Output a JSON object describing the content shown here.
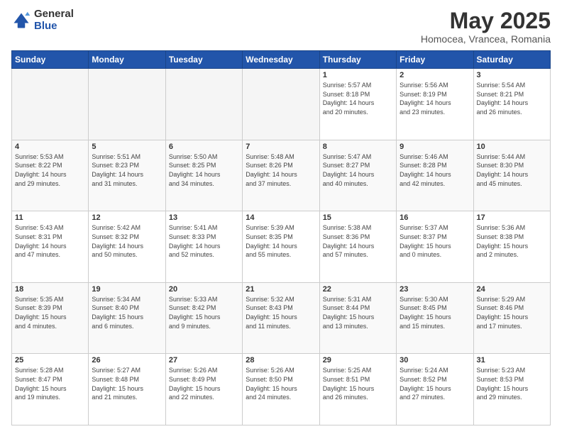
{
  "logo": {
    "general": "General",
    "blue": "Blue"
  },
  "title": "May 2025",
  "location": "Homocea, Vrancea, Romania",
  "weekdays": [
    "Sunday",
    "Monday",
    "Tuesday",
    "Wednesday",
    "Thursday",
    "Friday",
    "Saturday"
  ],
  "weeks": [
    [
      {
        "day": "",
        "info": ""
      },
      {
        "day": "",
        "info": ""
      },
      {
        "day": "",
        "info": ""
      },
      {
        "day": "",
        "info": ""
      },
      {
        "day": "1",
        "info": "Sunrise: 5:57 AM\nSunset: 8:18 PM\nDaylight: 14 hours\nand 20 minutes."
      },
      {
        "day": "2",
        "info": "Sunrise: 5:56 AM\nSunset: 8:19 PM\nDaylight: 14 hours\nand 23 minutes."
      },
      {
        "day": "3",
        "info": "Sunrise: 5:54 AM\nSunset: 8:21 PM\nDaylight: 14 hours\nand 26 minutes."
      }
    ],
    [
      {
        "day": "4",
        "info": "Sunrise: 5:53 AM\nSunset: 8:22 PM\nDaylight: 14 hours\nand 29 minutes."
      },
      {
        "day": "5",
        "info": "Sunrise: 5:51 AM\nSunset: 8:23 PM\nDaylight: 14 hours\nand 31 minutes."
      },
      {
        "day": "6",
        "info": "Sunrise: 5:50 AM\nSunset: 8:25 PM\nDaylight: 14 hours\nand 34 minutes."
      },
      {
        "day": "7",
        "info": "Sunrise: 5:48 AM\nSunset: 8:26 PM\nDaylight: 14 hours\nand 37 minutes."
      },
      {
        "day": "8",
        "info": "Sunrise: 5:47 AM\nSunset: 8:27 PM\nDaylight: 14 hours\nand 40 minutes."
      },
      {
        "day": "9",
        "info": "Sunrise: 5:46 AM\nSunset: 8:28 PM\nDaylight: 14 hours\nand 42 minutes."
      },
      {
        "day": "10",
        "info": "Sunrise: 5:44 AM\nSunset: 8:30 PM\nDaylight: 14 hours\nand 45 minutes."
      }
    ],
    [
      {
        "day": "11",
        "info": "Sunrise: 5:43 AM\nSunset: 8:31 PM\nDaylight: 14 hours\nand 47 minutes."
      },
      {
        "day": "12",
        "info": "Sunrise: 5:42 AM\nSunset: 8:32 PM\nDaylight: 14 hours\nand 50 minutes."
      },
      {
        "day": "13",
        "info": "Sunrise: 5:41 AM\nSunset: 8:33 PM\nDaylight: 14 hours\nand 52 minutes."
      },
      {
        "day": "14",
        "info": "Sunrise: 5:39 AM\nSunset: 8:35 PM\nDaylight: 14 hours\nand 55 minutes."
      },
      {
        "day": "15",
        "info": "Sunrise: 5:38 AM\nSunset: 8:36 PM\nDaylight: 14 hours\nand 57 minutes."
      },
      {
        "day": "16",
        "info": "Sunrise: 5:37 AM\nSunset: 8:37 PM\nDaylight: 15 hours\nand 0 minutes."
      },
      {
        "day": "17",
        "info": "Sunrise: 5:36 AM\nSunset: 8:38 PM\nDaylight: 15 hours\nand 2 minutes."
      }
    ],
    [
      {
        "day": "18",
        "info": "Sunrise: 5:35 AM\nSunset: 8:39 PM\nDaylight: 15 hours\nand 4 minutes."
      },
      {
        "day": "19",
        "info": "Sunrise: 5:34 AM\nSunset: 8:40 PM\nDaylight: 15 hours\nand 6 minutes."
      },
      {
        "day": "20",
        "info": "Sunrise: 5:33 AM\nSunset: 8:42 PM\nDaylight: 15 hours\nand 9 minutes."
      },
      {
        "day": "21",
        "info": "Sunrise: 5:32 AM\nSunset: 8:43 PM\nDaylight: 15 hours\nand 11 minutes."
      },
      {
        "day": "22",
        "info": "Sunrise: 5:31 AM\nSunset: 8:44 PM\nDaylight: 15 hours\nand 13 minutes."
      },
      {
        "day": "23",
        "info": "Sunrise: 5:30 AM\nSunset: 8:45 PM\nDaylight: 15 hours\nand 15 minutes."
      },
      {
        "day": "24",
        "info": "Sunrise: 5:29 AM\nSunset: 8:46 PM\nDaylight: 15 hours\nand 17 minutes."
      }
    ],
    [
      {
        "day": "25",
        "info": "Sunrise: 5:28 AM\nSunset: 8:47 PM\nDaylight: 15 hours\nand 19 minutes."
      },
      {
        "day": "26",
        "info": "Sunrise: 5:27 AM\nSunset: 8:48 PM\nDaylight: 15 hours\nand 21 minutes."
      },
      {
        "day": "27",
        "info": "Sunrise: 5:26 AM\nSunset: 8:49 PM\nDaylight: 15 hours\nand 22 minutes."
      },
      {
        "day": "28",
        "info": "Sunrise: 5:26 AM\nSunset: 8:50 PM\nDaylight: 15 hours\nand 24 minutes."
      },
      {
        "day": "29",
        "info": "Sunrise: 5:25 AM\nSunset: 8:51 PM\nDaylight: 15 hours\nand 26 minutes."
      },
      {
        "day": "30",
        "info": "Sunrise: 5:24 AM\nSunset: 8:52 PM\nDaylight: 15 hours\nand 27 minutes."
      },
      {
        "day": "31",
        "info": "Sunrise: 5:23 AM\nSunset: 8:53 PM\nDaylight: 15 hours\nand 29 minutes."
      }
    ]
  ]
}
